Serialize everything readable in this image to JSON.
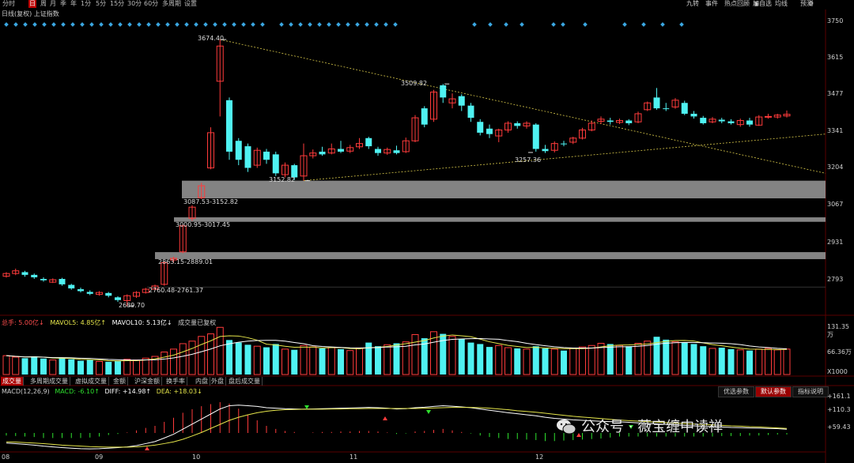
{
  "period_tabs": [
    "分时",
    "日",
    "周",
    "月",
    "季",
    "年",
    "1分",
    "5分",
    "15分",
    "30分",
    "60分",
    "多周期",
    "设置"
  ],
  "active_period": "日",
  "toolbar_right": [
    "九转",
    "事件",
    "热点回顾",
    "加自选",
    "均线",
    "预测"
  ],
  "chart_title": "日线(复权) 上证指数",
  "price_axis": [
    "3750",
    "3615",
    "3477",
    "3341",
    "3204",
    "3067",
    "2931",
    "2793"
  ],
  "price_notes": {
    "high": "3674.40",
    "mid_high": "3509.82",
    "low_a": "3152.82",
    "low_b": "3257.36",
    "low_c": "2689.70"
  },
  "zones": [
    "3087.53-3152.82",
    "3000.95-3017.45",
    "2863.15-2889.01",
    "2760.48-2761.37"
  ],
  "volume_header": {
    "total": "总手: 5.00亿↓",
    "ma5": "MAVOL5: 4.85亿↑",
    "ma10": "MAVOL10: 5.13亿↓",
    "note": "成交量已复权"
  },
  "volume_axis": [
    "131.35万",
    "66.36万",
    "X1000"
  ],
  "bottom_tabs": [
    "成交量",
    "多周期成交量",
    "虚拟成交量",
    "金额",
    "沪深金额",
    "换手率",
    "内盘",
    "外盘",
    "盘后成交量"
  ],
  "active_bottom_tab": "成交量",
  "macd_header": {
    "name": "MACD(12,26,9)",
    "macd": "MACD: -6.10↑",
    "diff": "DIFF: +14.98↑",
    "dea": "DEA: +18.03↓"
  },
  "param_buttons": [
    "优选参数",
    "默认参数",
    "指标说明"
  ],
  "active_param": "默认参数",
  "macd_axis": [
    "+161.1",
    "+110.3",
    "+59.43"
  ],
  "date_labels": [
    "08",
    "09",
    "10",
    "11",
    "12"
  ],
  "watermark": "公众号 · 薇宝缠中读禅",
  "colors": {
    "up": "#ff3b3b",
    "down": "#4ff2f2",
    "accent_tab": "#b00000",
    "trend_line": "#d8c84a",
    "zone": "#9a9a9a",
    "diff_line": "#ffffff",
    "dea_line": "#e5e54a"
  },
  "candles": [
    {
      "o": 2800,
      "c": 2810,
      "h": 2815,
      "l": 2795
    },
    {
      "o": 2810,
      "c": 2820,
      "h": 2828,
      "l": 2804
    },
    {
      "o": 2815,
      "c": 2805,
      "h": 2820,
      "l": 2798
    },
    {
      "o": 2805,
      "c": 2796,
      "h": 2810,
      "l": 2790
    },
    {
      "o": 2790,
      "c": 2785,
      "h": 2796,
      "l": 2780
    },
    {
      "o": 2778,
      "c": 2787,
      "h": 2792,
      "l": 2775
    },
    {
      "o": 2790,
      "c": 2770,
      "h": 2794,
      "l": 2765
    },
    {
      "o": 2768,
      "c": 2755,
      "h": 2772,
      "l": 2750
    },
    {
      "o": 2752,
      "c": 2745,
      "h": 2758,
      "l": 2740
    },
    {
      "o": 2742,
      "c": 2735,
      "h": 2748,
      "l": 2730
    },
    {
      "o": 2733,
      "c": 2740,
      "h": 2745,
      "l": 2728
    },
    {
      "o": 2738,
      "c": 2728,
      "h": 2742,
      "l": 2722
    },
    {
      "o": 2722,
      "c": 2712,
      "h": 2726,
      "l": 2705
    },
    {
      "o": 2710,
      "c": 2728,
      "h": 2733,
      "l": 2689
    },
    {
      "o": 2726,
      "c": 2740,
      "h": 2745,
      "l": 2720
    },
    {
      "o": 2740,
      "c": 2752,
      "h": 2757,
      "l": 2736
    },
    {
      "o": 2752,
      "c": 2764,
      "h": 2769,
      "l": 2748
    },
    {
      "o": 2770,
      "c": 2850,
      "h": 2855,
      "l": 2765
    },
    {
      "o": 2860,
      "c": 2866,
      "h": 2872,
      "l": 2850
    },
    {
      "o": 2890,
      "c": 2986,
      "h": 2992,
      "l": 2885
    },
    {
      "o": 3014,
      "c": 3055,
      "h": 3062,
      "l": 3005
    },
    {
      "o": 3090,
      "c": 3134,
      "h": 3145,
      "l": 3085
    },
    {
      "o": 3200,
      "c": 3330,
      "h": 3350,
      "l": 3195
    },
    {
      "o": 3520,
      "c": 3650,
      "h": 3674,
      "l": 3390
    },
    {
      "o": 3450,
      "c": 3260,
      "h": 3460,
      "l": 3230
    },
    {
      "o": 3300,
      "c": 3230,
      "h": 3310,
      "l": 3210
    },
    {
      "o": 3280,
      "c": 3200,
      "h": 3290,
      "l": 3185
    },
    {
      "o": 3210,
      "c": 3265,
      "h": 3275,
      "l": 3200
    },
    {
      "o": 3260,
      "c": 3230,
      "h": 3270,
      "l": 3215
    },
    {
      "o": 3250,
      "c": 3180,
      "h": 3260,
      "l": 3170
    },
    {
      "o": 3175,
      "c": 3210,
      "h": 3220,
      "l": 3165
    },
    {
      "o": 3210,
      "c": 3165,
      "h": 3215,
      "l": 3155
    },
    {
      "o": 3170,
      "c": 3245,
      "h": 3290,
      "l": 3153
    },
    {
      "o": 3245,
      "c": 3255,
      "h": 3268,
      "l": 3235
    },
    {
      "o": 3260,
      "c": 3250,
      "h": 3278,
      "l": 3245
    },
    {
      "o": 3255,
      "c": 3270,
      "h": 3290,
      "l": 3250
    },
    {
      "o": 3270,
      "c": 3260,
      "h": 3300,
      "l": 3255
    },
    {
      "o": 3262,
      "c": 3275,
      "h": 3285,
      "l": 3255
    },
    {
      "o": 3278,
      "c": 3290,
      "h": 3310,
      "l": 3270
    },
    {
      "o": 3310,
      "c": 3280,
      "h": 3315,
      "l": 3270
    },
    {
      "o": 3270,
      "c": 3255,
      "h": 3278,
      "l": 3245
    },
    {
      "o": 3255,
      "c": 3268,
      "h": 3275,
      "l": 3248
    },
    {
      "o": 3265,
      "c": 3255,
      "h": 3282,
      "l": 3250
    },
    {
      "o": 3260,
      "c": 3300,
      "h": 3312,
      "l": 3255
    },
    {
      "o": 3300,
      "c": 3385,
      "h": 3395,
      "l": 3295
    },
    {
      "o": 3420,
      "c": 3360,
      "h": 3428,
      "l": 3350
    },
    {
      "o": 3380,
      "c": 3480,
      "h": 3488,
      "l": 3370
    },
    {
      "o": 3505,
      "c": 3460,
      "h": 3510,
      "l": 3440
    },
    {
      "o": 3440,
      "c": 3455,
      "h": 3475,
      "l": 3420
    },
    {
      "o": 3465,
      "c": 3430,
      "h": 3472,
      "l": 3410
    },
    {
      "o": 3430,
      "c": 3385,
      "h": 3440,
      "l": 3370
    },
    {
      "o": 3370,
      "c": 3330,
      "h": 3380,
      "l": 3320
    },
    {
      "o": 3345,
      "c": 3325,
      "h": 3360,
      "l": 3310
    },
    {
      "o": 3318,
      "c": 3340,
      "h": 3345,
      "l": 3295
    },
    {
      "o": 3340,
      "c": 3365,
      "h": 3372,
      "l": 3330
    },
    {
      "o": 3365,
      "c": 3355,
      "h": 3372,
      "l": 3345
    },
    {
      "o": 3355,
      "c": 3365,
      "h": 3372,
      "l": 3345
    },
    {
      "o": 3360,
      "c": 3270,
      "h": 3365,
      "l": 3260
    },
    {
      "o": 3270,
      "c": 3262,
      "h": 3285,
      "l": 3255
    },
    {
      "o": 3265,
      "c": 3290,
      "h": 3298,
      "l": 3257
    },
    {
      "o": 3290,
      "c": 3288,
      "h": 3300,
      "l": 3280
    },
    {
      "o": 3295,
      "c": 3310,
      "h": 3315,
      "l": 3288
    },
    {
      "o": 3310,
      "c": 3340,
      "h": 3348,
      "l": 3305
    },
    {
      "o": 3340,
      "c": 3365,
      "h": 3375,
      "l": 3335
    },
    {
      "o": 3372,
      "c": 3380,
      "h": 3390,
      "l": 3362
    },
    {
      "o": 3375,
      "c": 3370,
      "h": 3385,
      "l": 3360
    },
    {
      "o": 3368,
      "c": 3375,
      "h": 3382,
      "l": 3362
    },
    {
      "o": 3375,
      "c": 3365,
      "h": 3380,
      "l": 3358
    },
    {
      "o": 3370,
      "c": 3400,
      "h": 3408,
      "l": 3365
    },
    {
      "o": 3415,
      "c": 3440,
      "h": 3445,
      "l": 3410
    },
    {
      "o": 3460,
      "c": 3420,
      "h": 3495,
      "l": 3415
    },
    {
      "o": 3420,
      "c": 3418,
      "h": 3440,
      "l": 3410
    },
    {
      "o": 3425,
      "c": 3450,
      "h": 3458,
      "l": 3418
    },
    {
      "o": 3440,
      "c": 3400,
      "h": 3448,
      "l": 3395
    },
    {
      "o": 3400,
      "c": 3390,
      "h": 3410,
      "l": 3382
    },
    {
      "o": 3385,
      "c": 3365,
      "h": 3392,
      "l": 3360
    },
    {
      "o": 3370,
      "c": 3380,
      "h": 3388,
      "l": 3365
    },
    {
      "o": 3378,
      "c": 3372,
      "h": 3385,
      "l": 3365
    },
    {
      "o": 3372,
      "c": 3365,
      "h": 3380,
      "l": 3360
    },
    {
      "o": 3360,
      "c": 3375,
      "h": 3382,
      "l": 3352
    },
    {
      "o": 3375,
      "c": 3360,
      "h": 3385,
      "l": 3352
    },
    {
      "o": 3358,
      "c": 3388,
      "h": 3395,
      "l": 3355
    },
    {
      "o": 3388,
      "c": 3390,
      "h": 3400,
      "l": 3382
    },
    {
      "o": 3388,
      "c": 3395,
      "h": 3400,
      "l": 3382
    },
    {
      "o": 3392,
      "c": 3398,
      "h": 3412,
      "l": 3386
    }
  ],
  "volumes": [
    52,
    48,
    45,
    50,
    44,
    40,
    46,
    42,
    38,
    40,
    36,
    35,
    38,
    42,
    40,
    45,
    50,
    62,
    70,
    85,
    92,
    105,
    112,
    130,
    95,
    88,
    82,
    78,
    75,
    84,
    70,
    68,
    80,
    76,
    72,
    74,
    70,
    66,
    72,
    88,
    78,
    82,
    86,
    90,
    110,
    100,
    118,
    112,
    105,
    98,
    88,
    84,
    76,
    80,
    74,
    72,
    70,
    78,
    72,
    70,
    66,
    72,
    76,
    80,
    86,
    84,
    80,
    78,
    86,
    92,
    104,
    96,
    90,
    88,
    84,
    78,
    72,
    74,
    70,
    68,
    66,
    70,
    72,
    68,
    70
  ],
  "macd_diff": [
    -40,
    -42,
    -45,
    -48,
    -52,
    -55,
    -58,
    -60,
    -62,
    -63,
    -62,
    -60,
    -58,
    -55,
    -50,
    -42,
    -34,
    -20,
    -5,
    15,
    35,
    55,
    75,
    95,
    108,
    110,
    108,
    105,
    100,
    98,
    96,
    95,
    94,
    95,
    96,
    97,
    98,
    99,
    100,
    101,
    100,
    98,
    95,
    96,
    100,
    102,
    105,
    108,
    106,
    103,
    100,
    95,
    90,
    85,
    80,
    76,
    72,
    68,
    62,
    58,
    55,
    52,
    50,
    48,
    46,
    45,
    44,
    42,
    40,
    38,
    36,
    34,
    32,
    30,
    28,
    26,
    25,
    24,
    22,
    21,
    20,
    19,
    18,
    17,
    15
  ],
  "macd_dea": [
    -35,
    -36,
    -38,
    -40,
    -42,
    -45,
    -48,
    -50,
    -52,
    -54,
    -55,
    -56,
    -56,
    -56,
    -55,
    -52,
    -48,
    -42,
    -35,
    -25,
    -12,
    2,
    18,
    34,
    50,
    62,
    72,
    80,
    86,
    90,
    92,
    93,
    94,
    94,
    94,
    95,
    95,
    96,
    96,
    97,
    97,
    97,
    97,
    97,
    97,
    98,
    99,
    100,
    101,
    101,
    101,
    100,
    98,
    95,
    92,
    88,
    85,
    82,
    78,
    74,
    70,
    66,
    63,
    60,
    57,
    54,
    51,
    49,
    47,
    45,
    43,
    41,
    39,
    37,
    35,
    33,
    32,
    30,
    28,
    27,
    25,
    24,
    22,
    20,
    18
  ]
}
